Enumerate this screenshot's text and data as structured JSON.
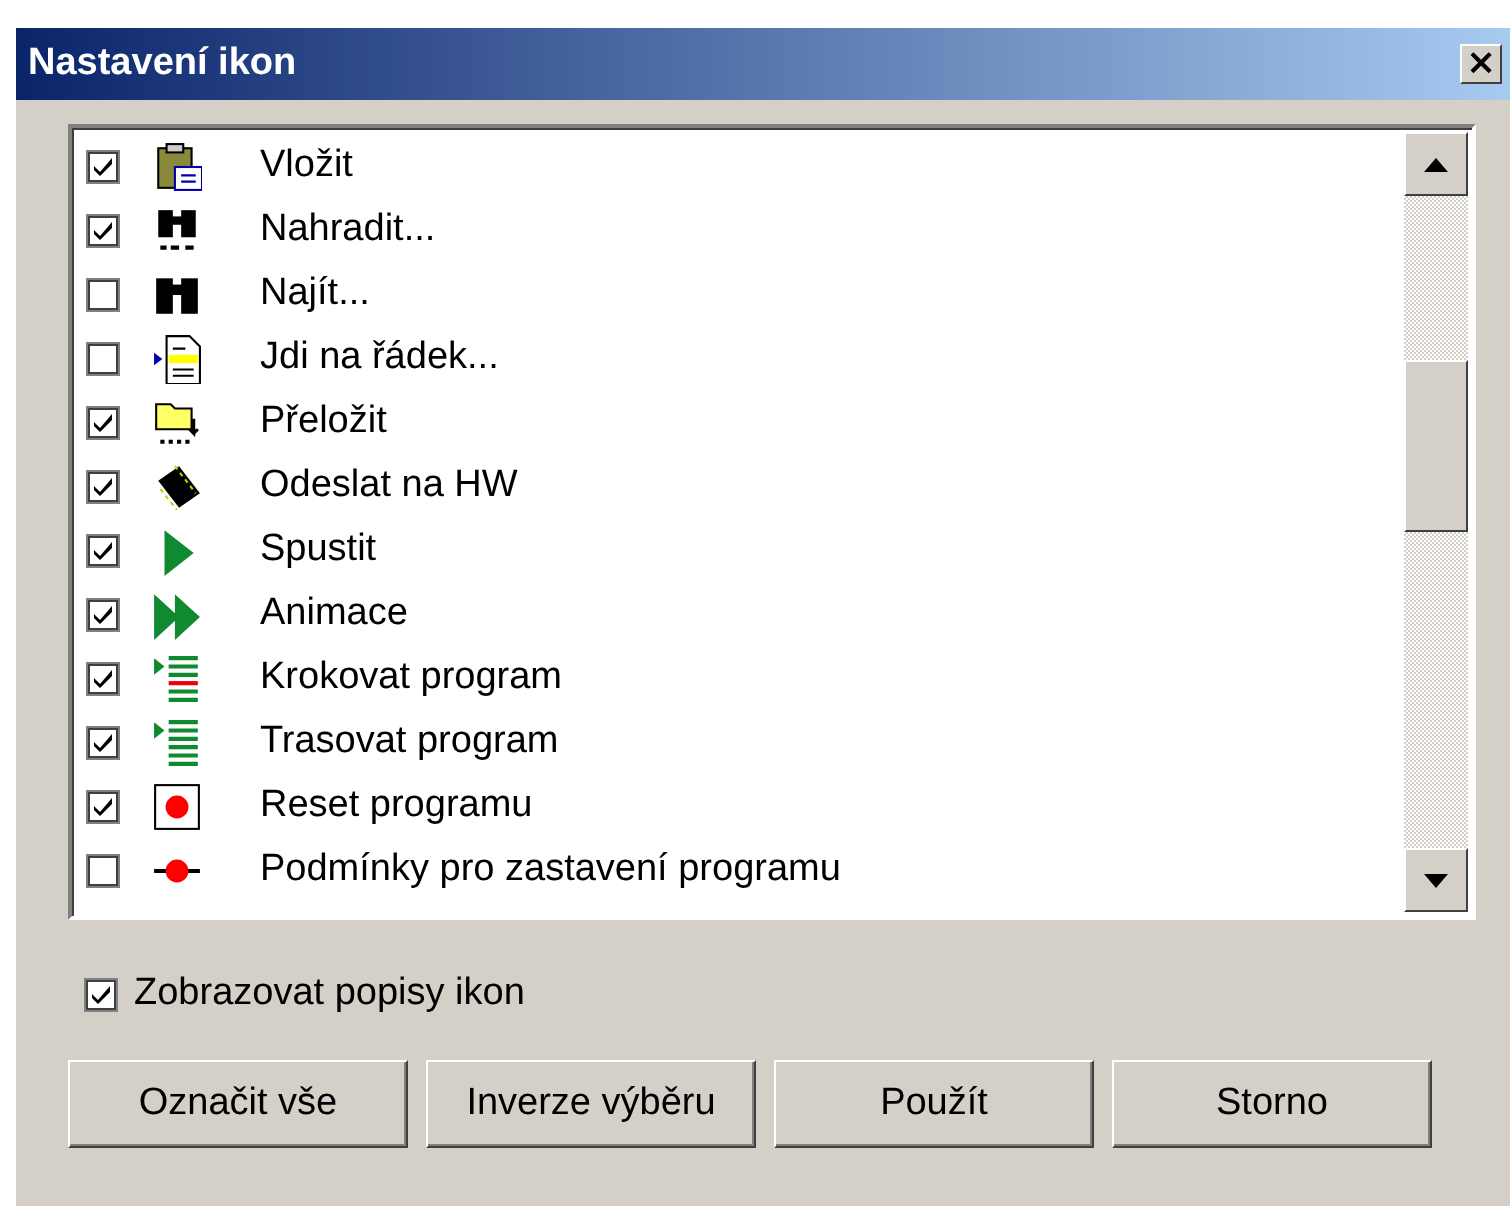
{
  "window": {
    "title": "Nastavení ikon",
    "close": "×"
  },
  "list": {
    "items": [
      {
        "label": "Vložit",
        "checked": true
      },
      {
        "label": "Nahradit...",
        "checked": true
      },
      {
        "label": "Najít...",
        "checked": false
      },
      {
        "label": "Jdi na řádek...",
        "checked": false
      },
      {
        "label": "Přeložit",
        "checked": true
      },
      {
        "label": "Odeslat na HW",
        "checked": true
      },
      {
        "label": "Spustit",
        "checked": true
      },
      {
        "label": "Animace",
        "checked": true
      },
      {
        "label": "Krokovat program",
        "checked": true
      },
      {
        "label": "Trasovat program",
        "checked": true
      },
      {
        "label": "Reset programu",
        "checked": true
      },
      {
        "label": "Podmínky pro zastavení programu",
        "checked": false
      }
    ]
  },
  "show_labels": {
    "label": "Zobrazovat popisy ikon",
    "checked": true
  },
  "buttons": [
    "Označit vše",
    "Inverze výběru",
    "Použít",
    "Storno"
  ]
}
